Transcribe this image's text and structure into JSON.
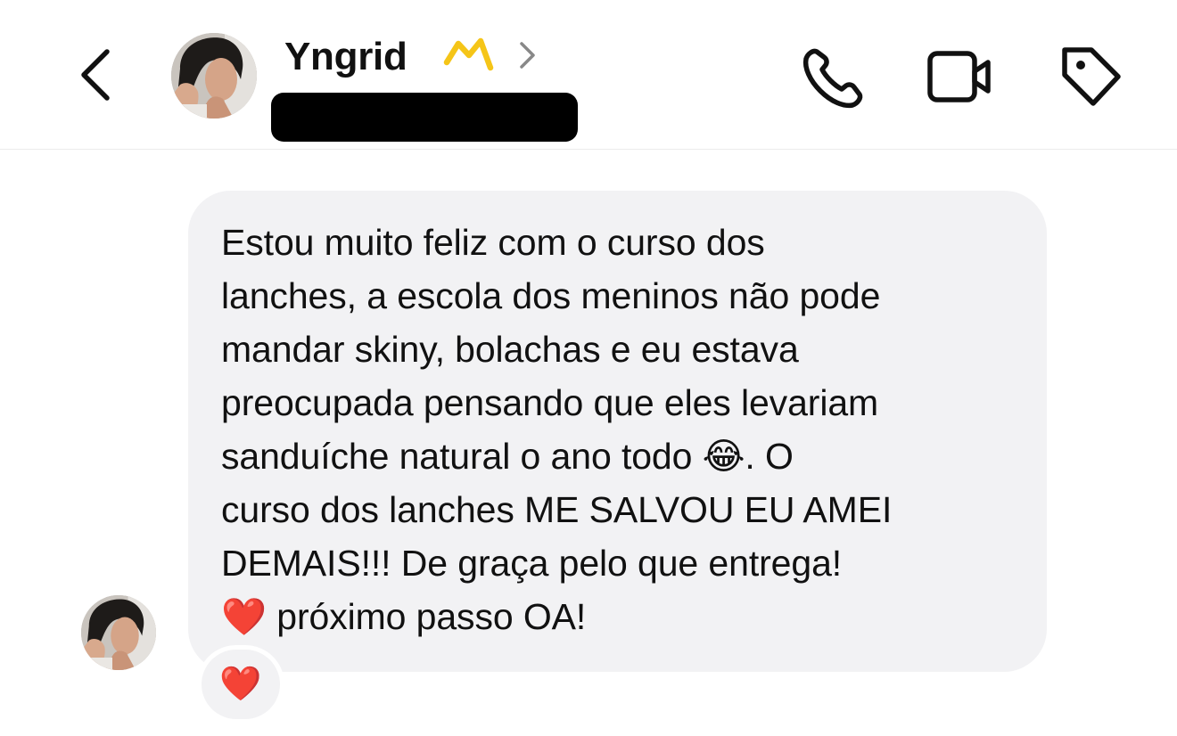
{
  "header": {
    "contact_name": "Yngrid",
    "username_redacted": true,
    "icons": {
      "back": "chevron-left-icon",
      "verified": "crown-icon",
      "profile": "chevron-right-icon",
      "call": "phone-icon",
      "video": "video-camera-icon",
      "tag": "tag-icon"
    },
    "accent_color": "#f5c518"
  },
  "message": {
    "text": "Estou muito feliz com o curso dos\nlanches, a escola dos meninos não pode\nmandar skiny, bolachas e eu estava\npreocupada pensando que eles levariam\nsanduíche natural o ano todo 😂. O\ncurso dos lanches ME SALVOU EU AMEI\nDEMAIS!!! De graça pelo que entrega!\n❤️ próximo passo OA!",
    "bubble_color": "#f2f2f4"
  },
  "reaction": {
    "emoji": "❤️"
  }
}
